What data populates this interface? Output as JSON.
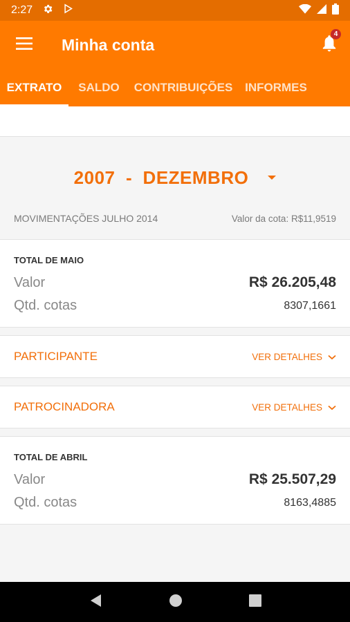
{
  "status_bar": {
    "time": "2:27"
  },
  "app_bar": {
    "title": "Minha conta",
    "notification_count": "4"
  },
  "tabs": [
    {
      "label": "EXTRATO",
      "active": true
    },
    {
      "label": "SALDO",
      "active": false
    },
    {
      "label": "CONTRIBUIÇÕES",
      "active": false
    },
    {
      "label": "INFORMES",
      "active": false
    }
  ],
  "period": {
    "selected": "2007  -  DEZEMBRO"
  },
  "movements": {
    "label": "MOVIMENTAÇÕES JULHO 2014",
    "quota_value": "Valor da cota: R$11,9519"
  },
  "totals": [
    {
      "label": "TOTAL DE MAIO",
      "value_label": "Valor",
      "value": "R$ 26.205,48",
      "quotas_label": "Qtd. cotas",
      "quotas": "8307,1661"
    },
    {
      "label": "TOTAL DE ABRIL",
      "value_label": "Valor",
      "value": "R$ 25.507,29",
      "quotas_label": "Qtd. cotas",
      "quotas": "8163,4885"
    }
  ],
  "sections": [
    {
      "label": "PARTICIPANTE",
      "link": "VER DETALHES"
    },
    {
      "label": "PATROCINADORA",
      "link": "VER DETALHES"
    }
  ],
  "colors": {
    "app_bar": "#ff7a00",
    "status_bar": "#e46d00",
    "accent": "#f26f0a"
  }
}
